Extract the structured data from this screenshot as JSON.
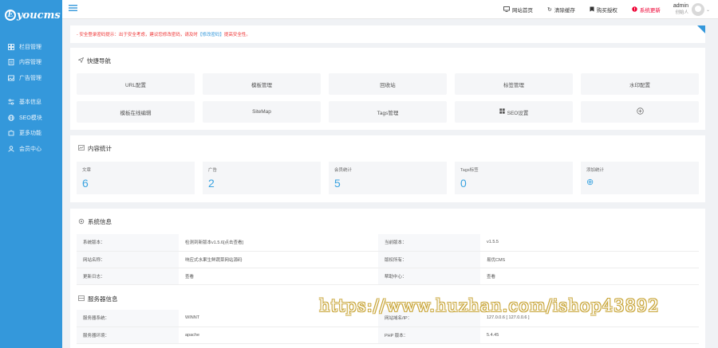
{
  "brand": {
    "logo_letter": "E",
    "logo_text": "youcms"
  },
  "sidebar": {
    "items": [
      {
        "label": "栏目管理",
        "icon": "grid-icon"
      },
      {
        "label": "内容管理",
        "icon": "doc-icon"
      },
      {
        "label": "广告管理",
        "icon": "image-icon"
      },
      {
        "label": "基本信息",
        "icon": "sliders-icon"
      },
      {
        "label": "SEO模块",
        "icon": "globe-icon"
      },
      {
        "label": "更多功能",
        "icon": "puzzle-icon"
      },
      {
        "label": "会员中心",
        "icon": "user-icon"
      }
    ]
  },
  "topbar": {
    "links": [
      {
        "label": "网站首页",
        "icon": "monitor-icon"
      },
      {
        "label": "清除缓存",
        "icon": "refresh-icon"
      },
      {
        "label": "购买授权",
        "icon": "bookmark-icon"
      },
      {
        "label": "系统更新",
        "icon": "alert-icon"
      }
    ],
    "admin_name": "admin",
    "admin_role": "创始人"
  },
  "notice": {
    "text": "- 安全登录密码提示：出于安全考虑，建议您修改密码，请及时",
    "link": "【修改密码】",
    "suffix": "提高安全性。"
  },
  "quick": {
    "title": "快捷导航",
    "items": [
      {
        "label": "URL配置"
      },
      {
        "label": "模板管理"
      },
      {
        "label": "回收站"
      },
      {
        "label": "标签管理"
      },
      {
        "label": "水印配置"
      },
      {
        "label": "模板在线编辑"
      },
      {
        "label": "SiteMap"
      },
      {
        "label": "Tags管理"
      },
      {
        "label": "SEO设置",
        "icon": "grid-icon"
      },
      {
        "label": "",
        "icon": "plus-circle-icon"
      }
    ]
  },
  "stats": {
    "title": "内容统计",
    "items": [
      {
        "label": "文章",
        "value": "6"
      },
      {
        "label": "广告",
        "value": "2"
      },
      {
        "label": "会员统计",
        "value": "5"
      },
      {
        "label": "Tags标签",
        "value": "0"
      },
      {
        "label": "添加统计",
        "value": "⊕"
      }
    ]
  },
  "system": {
    "title": "系统信息",
    "rows": [
      {
        "k1": "系统版本：",
        "v1": "检测到新版本v1.5.6[点击查看]",
        "k2": "当前版本：",
        "v2": "v1.5.5"
      },
      {
        "k1": "网站名称：",
        "v1": "响应式水果生鲜蔬菜网站源码",
        "k2": "版权所有：",
        "v2": "易优CMS"
      },
      {
        "k1": "更新日志：",
        "v1": "查看",
        "k2": "帮助中心：",
        "v2": "查看"
      }
    ]
  },
  "server": {
    "title": "服务器信息",
    "rows": [
      {
        "k1": "服务器系统：",
        "v1": "WINNT",
        "k2": "网站域名/IP：",
        "v2": "127.0.0.6 [ 127.0.0.6 ]"
      },
      {
        "k1": "服务器环境：",
        "v1": "apache",
        "k2": "PHP 版本：",
        "v2": "5.4.45"
      }
    ]
  },
  "watermark": "https://www.huzhan.com/ishop43892"
}
